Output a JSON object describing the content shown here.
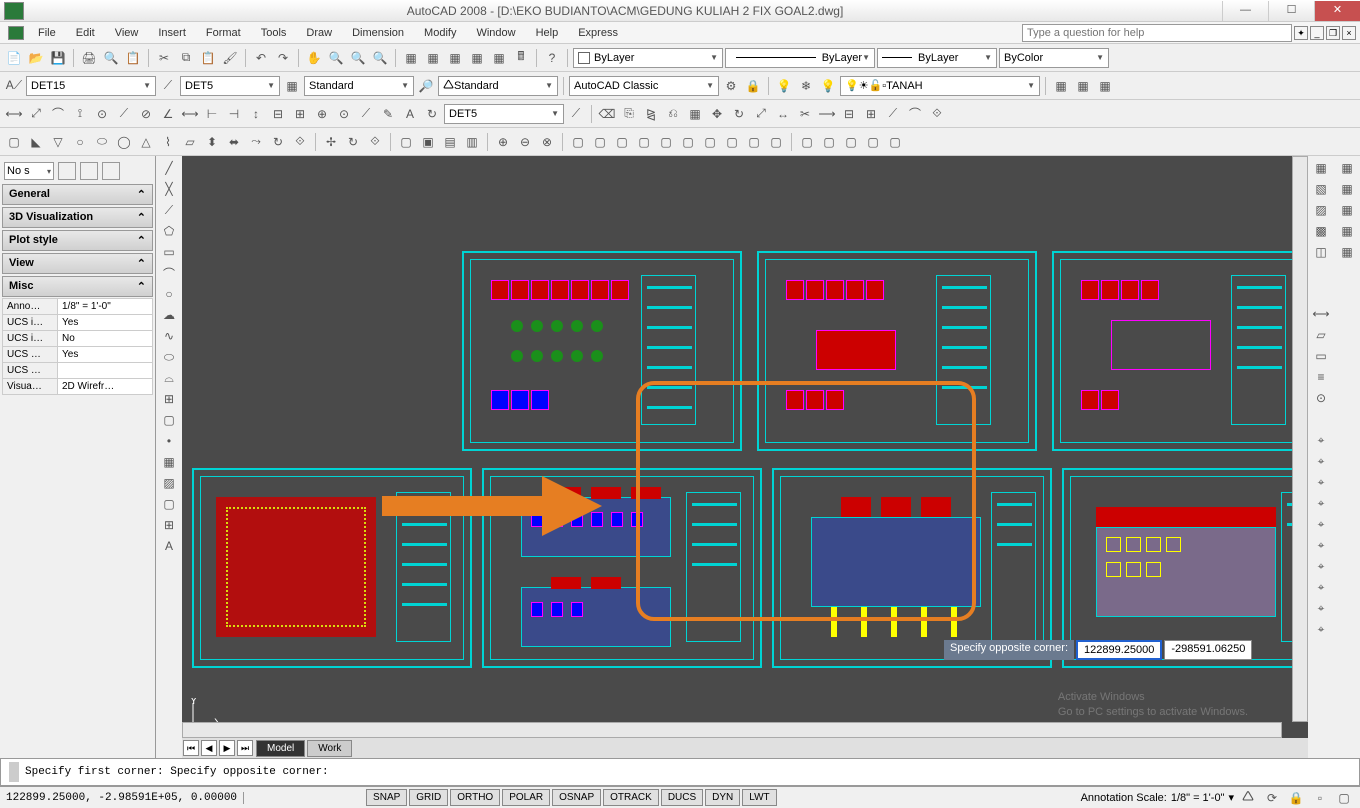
{
  "title": "AutoCAD 2008 - [D:\\EKO BUDIANTO\\ACM\\GEDUNG KULIAH 2 FIX GOAL2.dwg]",
  "help_placeholder": "Type a question for help",
  "menu": [
    "File",
    "Edit",
    "View",
    "Insert",
    "Format",
    "Tools",
    "Draw",
    "Dimension",
    "Modify",
    "Window",
    "Help",
    "Express"
  ],
  "bylayer": "ByLayer",
  "bycolor": "ByColor",
  "dimstyle1": "DET15",
  "dimstyle2": "DET5",
  "textstyle": "Standard",
  "tablestyle": "Standard",
  "workspace": "AutoCAD Classic",
  "layer": "TANAH",
  "tb4_combo": "DET5",
  "palette_selector": "No s",
  "palettes": [
    "General",
    "3D Visualization",
    "Plot style",
    "View",
    "Misc"
  ],
  "props": [
    {
      "k": "Anno…",
      "v": "1/8\" = 1'-0\""
    },
    {
      "k": "UCS i…",
      "v": "Yes"
    },
    {
      "k": "UCS i…",
      "v": "No"
    },
    {
      "k": "UCS …",
      "v": "Yes"
    },
    {
      "k": "UCS …",
      "v": ""
    },
    {
      "k": "Visua…",
      "v": "2D Wirefr…"
    }
  ],
  "tabs": {
    "model": "Model",
    "work": "Work"
  },
  "tooltip": {
    "label": "Specify opposite corner:",
    "v1": "122899.25000",
    "v2": "-298591.06250"
  },
  "cmd": "Specify first corner: Specify opposite corner:",
  "coord": "122899.25000, -2.98591E+05, 0.00000",
  "stat_btns": [
    "SNAP",
    "GRID",
    "ORTHO",
    "POLAR",
    "OSNAP",
    "OTRACK",
    "DUCS",
    "DYN",
    "LWT"
  ],
  "anno_scale_label": "Annotation Scale:",
  "anno_scale": "1/8\" = 1'-0\"",
  "watermark": {
    "t": "Activate Windows",
    "s": "Go to PC settings to activate Windows."
  }
}
